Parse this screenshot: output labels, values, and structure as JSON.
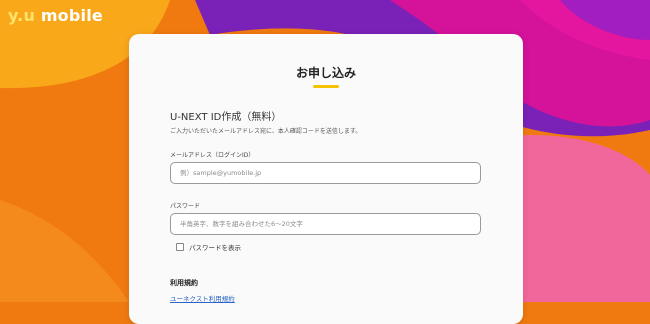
{
  "brand": {
    "logo_prefix": "y.u",
    "logo_suffix": "mobile"
  },
  "colors": {
    "orange": "#f07a10",
    "purple": "#7a22b8",
    "magenta": "#e0159a",
    "pink": "#f2679b",
    "accent": "#f5c300",
    "link": "#2b64c8"
  },
  "form": {
    "title": "お申し込み",
    "section_title": "U-NEXT ID作成（無料）",
    "section_desc": "ご入力いただいたメールアドレス宛に、本人確認コードを送信します。",
    "email": {
      "label": "メールアドレス（ログインID）",
      "placeholder": "例）sample@yumobile.jp",
      "value": ""
    },
    "password": {
      "label": "パスワード",
      "placeholder": "半角英字、数字を組み合わせた6〜20文字",
      "value": ""
    },
    "show_password_label": "パスワードを表示",
    "terms_title": "利用規約",
    "terms_link": "ユーネクスト利用規約"
  }
}
